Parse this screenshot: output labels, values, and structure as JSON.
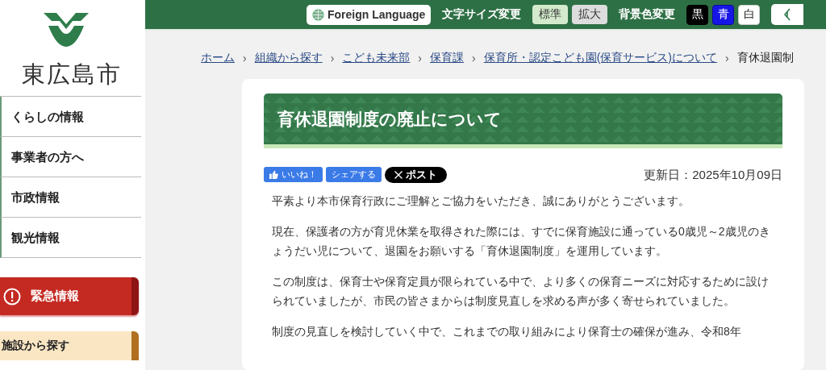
{
  "site": {
    "name": "東広島市"
  },
  "nav": [
    {
      "label": "くらしの情報"
    },
    {
      "label": "事業者の方へ"
    },
    {
      "label": "市政情報"
    },
    {
      "label": "観光情報"
    }
  ],
  "emergency": {
    "label": "緊急情報"
  },
  "facility": {
    "label": "施設から探す"
  },
  "header": {
    "foreign_language": "Foreign Language",
    "font_size_label": "文字サイズ変更",
    "font_sizes": [
      {
        "label": "標準",
        "selected": true
      },
      {
        "label": "拡大",
        "selected": false
      }
    ],
    "bg_color_label": "背景色変更",
    "bg_colors": [
      {
        "label": "黒",
        "kind": "black"
      },
      {
        "label": "青",
        "kind": "blue"
      },
      {
        "label": "白",
        "kind": "white"
      }
    ]
  },
  "breadcrumb_separator": "›",
  "breadcrumb": [
    {
      "label": "ホーム",
      "link": true
    },
    {
      "label": "組織から探す",
      "link": true
    },
    {
      "label": "こども未来部",
      "link": true
    },
    {
      "label": "保育課",
      "link": true
    },
    {
      "label": "保育所・認定こども園(保育サービス)について",
      "link": true
    },
    {
      "label": "育休退園制",
      "link": false
    }
  ],
  "article": {
    "title": "育休退園制度の廃止について",
    "share": [
      {
        "label": "いいね！",
        "kind": "like"
      },
      {
        "label": "シェアする",
        "kind": "share"
      },
      {
        "label": "ポスト",
        "kind": "x"
      }
    ],
    "updated": "更新日：2025年10月09日",
    "paragraphs": [
      "平素より本市保育行政にご理解とご協力をいただき、誠にありがとうございます。",
      "現在、保護者の方が育児休業を取得された際には、すでに保育施設に通っている0歳児～2歳児のきょうだい児について、退園をお願いする「育休退園制度」を運用しています。",
      "この制度は、保育士や保育定員が限られている中で、より多くの保育ニーズに対応するために設けられていましたが、市民の皆さまからは制度見直しを求める声が多く寄せられていました。",
      "制度の見直しを検討していく中で、これまでの取り組みにより保育士の確保が進み、令和8年"
    ]
  }
}
